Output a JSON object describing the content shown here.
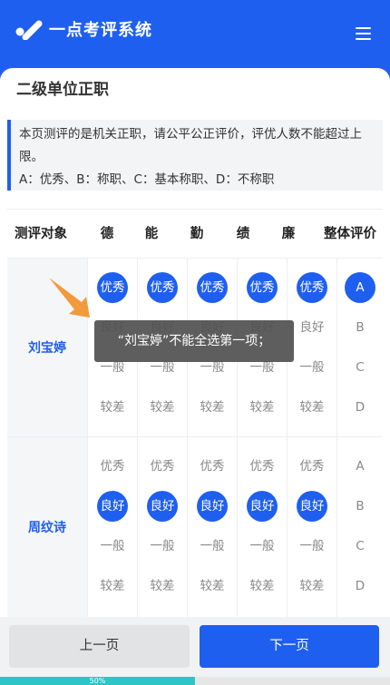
{
  "header": {
    "app_title": "一点考评系统",
    "logo_icon": "check-logo-icon",
    "menu_icon": "hamburger-menu-icon"
  },
  "page": {
    "title": "二级单位正职",
    "notice": "本页测评的是机关正职，请公平公正评价，评优人数不能超过上限。",
    "legend": "A：优秀、B：称职、C：基本称职、D：不称职"
  },
  "table": {
    "headers": [
      "测评对象",
      "德",
      "能",
      "勤",
      "绩",
      "廉",
      "整体评价"
    ],
    "criteria_options": [
      "优秀",
      "良好",
      "一般",
      "较差"
    ],
    "overall_options": [
      "A",
      "B",
      "C",
      "D"
    ],
    "rows": [
      {
        "name": "刘宝婷",
        "selected_criteria": [
          0,
          0,
          0,
          0,
          0
        ],
        "selected_overall": 0
      },
      {
        "name": "周纹诗",
        "selected_criteria": [
          1,
          1,
          1,
          1,
          1
        ],
        "selected_overall": -1
      }
    ]
  },
  "toast": {
    "message": "“刘宝婷”不能全选第一项；"
  },
  "footer": {
    "prev_label": "上一页",
    "next_label": "下一页"
  },
  "progress": {
    "percent": 50,
    "label": "50%"
  },
  "colors": {
    "primary": "#1f5ff0",
    "progress": "#2cc6c4",
    "arrow": "#f39a3c"
  }
}
